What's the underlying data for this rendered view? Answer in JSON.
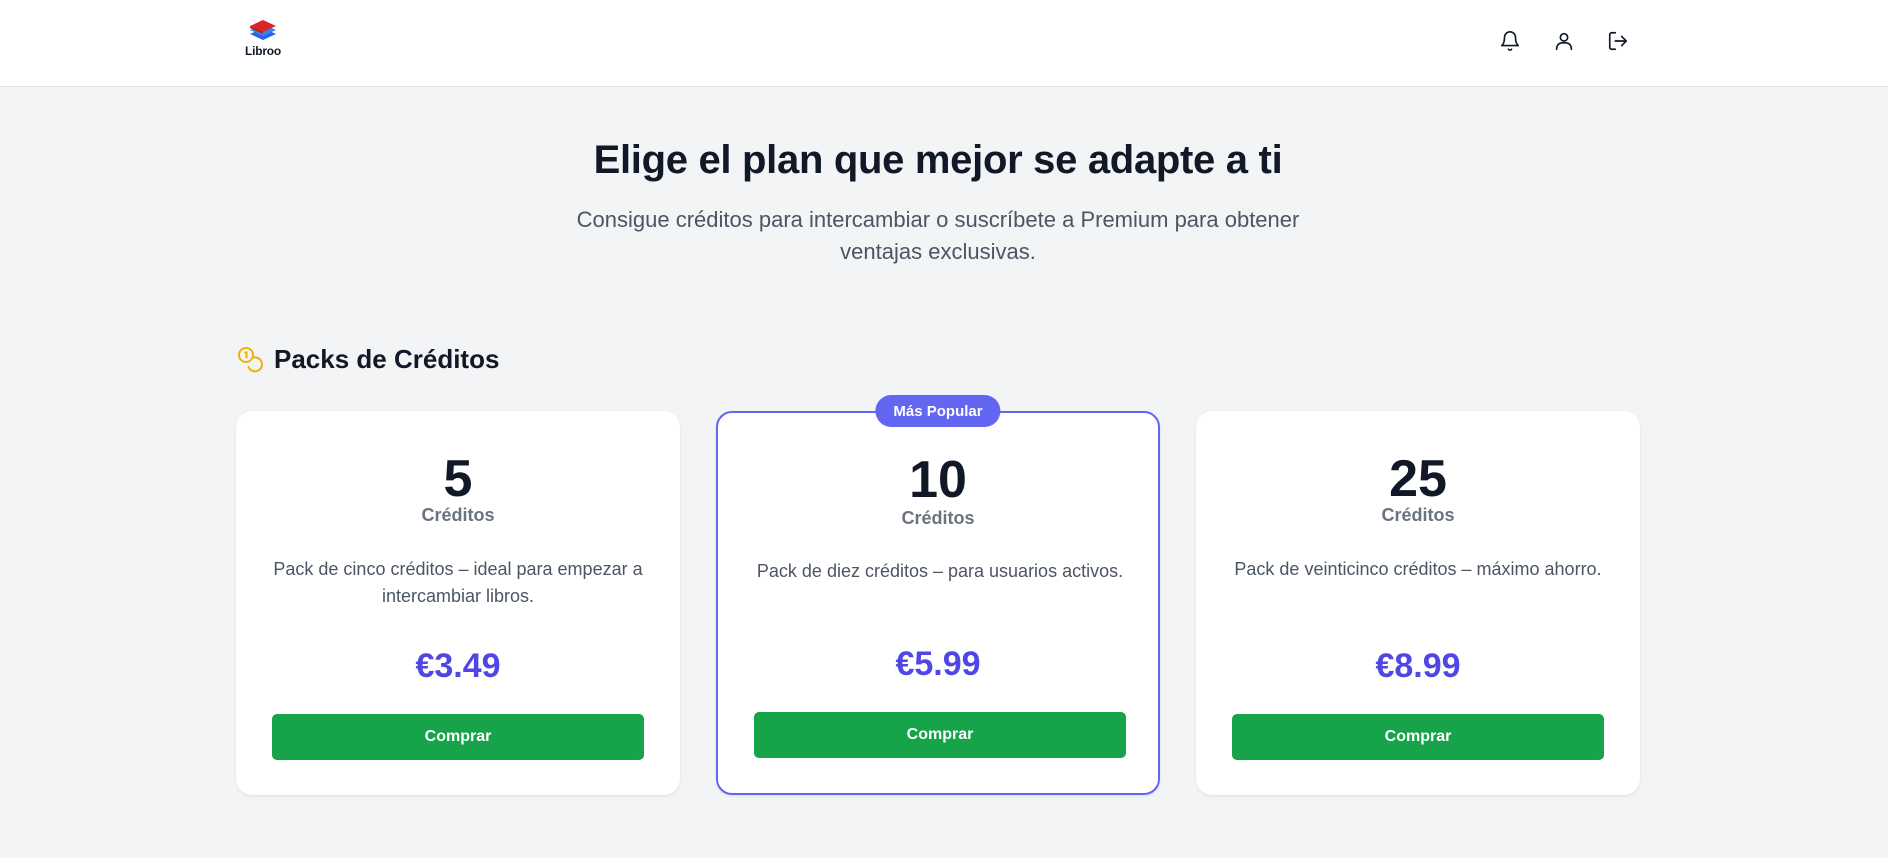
{
  "header": {
    "logo_text": "Libroo",
    "icons": [
      "bell-icon",
      "user-icon",
      "logout-icon"
    ]
  },
  "hero": {
    "title": "Elige el plan que mejor se adapte a ti",
    "subtitle": "Consigue créditos para intercambiar o suscríbete a Premium para obtener ventajas exclusivas."
  },
  "section": {
    "icon": "coins-icon",
    "title": "Packs de Créditos"
  },
  "packs": [
    {
      "amount": "5",
      "unit": "Créditos",
      "description": "Pack de cinco créditos – ideal para empezar a intercambiar libros.",
      "price": "€3.49",
      "button": "Comprar"
    },
    {
      "badge": "Más Popular",
      "amount": "10",
      "unit": "Créditos",
      "description": "Pack de diez créditos – para usuarios activos.",
      "price": "€5.99",
      "button": "Comprar"
    },
    {
      "amount": "25",
      "unit": "Créditos",
      "description": "Pack de veinticinco créditos – máximo ahorro.",
      "price": "€8.99",
      "button": "Comprar"
    }
  ],
  "colors": {
    "accent": "#6366f1",
    "price": "#4f46e5",
    "button": "#16a34a",
    "coin": "#eab308"
  }
}
